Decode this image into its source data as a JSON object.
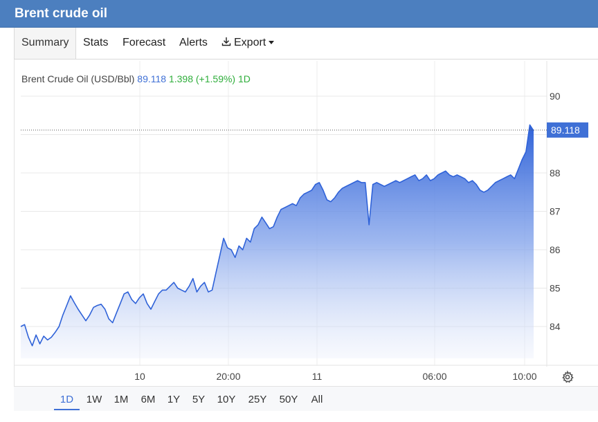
{
  "title": "Brent crude oil",
  "tabs": [
    {
      "label": "Summary"
    },
    {
      "label": "Stats"
    },
    {
      "label": "Forecast"
    },
    {
      "label": "Alerts"
    },
    {
      "label": "Export",
      "icon": "download-icon"
    }
  ],
  "legend": {
    "name": "Brent Crude Oil (USD/Bbl)",
    "price": "89.118",
    "change": "1.398",
    "change_pct": "(+1.59%)",
    "period": "1D"
  },
  "ranges": [
    "1D",
    "1W",
    "1M",
    "6M",
    "1Y",
    "5Y",
    "10Y",
    "25Y",
    "50Y",
    "All"
  ],
  "active_range": "1D",
  "colors": {
    "header": "#4c7fbf",
    "series": "#2f62d8",
    "price_label_bg": "#3f70d6",
    "change_green": "#2fae3b"
  },
  "chart_data": {
    "type": "area",
    "series": [
      {
        "values": [
          84.0,
          84.05,
          83.72,
          83.5,
          83.78,
          83.55,
          83.75,
          83.65,
          83.72,
          83.85,
          84.0,
          84.3,
          84.55,
          84.8,
          84.62,
          84.45,
          84.3,
          84.15,
          84.3,
          84.5,
          84.55,
          84.58,
          84.45,
          84.2,
          84.1,
          84.35,
          84.6,
          84.85,
          84.9,
          84.7,
          84.6,
          84.75,
          84.85,
          84.6,
          84.45,
          84.65,
          84.85,
          84.95,
          84.95,
          85.05,
          85.15,
          85.0,
          84.95,
          84.9,
          85.05,
          85.25,
          84.9,
          85.05,
          85.15,
          84.9,
          84.95,
          85.4,
          85.85,
          86.3,
          86.05,
          86.0,
          85.8,
          86.1,
          86.0,
          86.3,
          86.2,
          86.55,
          86.65,
          86.85,
          86.7,
          86.55,
          86.6,
          86.85,
          87.05,
          87.1,
          87.15,
          87.2,
          87.15,
          87.35,
          87.45,
          87.5,
          87.55,
          87.7,
          87.75,
          87.55,
          87.3,
          87.25,
          87.35,
          87.5,
          87.6,
          87.65,
          87.7,
          87.75,
          87.8,
          87.75,
          87.75,
          86.65,
          87.7,
          87.75,
          87.7,
          87.65,
          87.7,
          87.75,
          87.8,
          87.75,
          87.8,
          87.85,
          87.9,
          87.95,
          87.8,
          87.85,
          87.95,
          87.8,
          87.85,
          87.95,
          88.0,
          88.05,
          87.95,
          87.9,
          87.95,
          87.9,
          87.85,
          87.75,
          87.8,
          87.7,
          87.55,
          87.5,
          87.55,
          87.65,
          87.75,
          87.8,
          87.85,
          87.9,
          87.95,
          87.85,
          88.1,
          88.35,
          88.55,
          89.25,
          89.1
        ]
      }
    ],
    "x_ticks": [
      "10",
      "20:00",
      "11",
      "06:00",
      "10:00"
    ],
    "y_ticks": [
      84,
      85,
      86,
      87,
      88,
      89,
      90
    ],
    "ylim": [
      83.2,
      90.4
    ],
    "last_value": "89.118",
    "grid": true
  }
}
